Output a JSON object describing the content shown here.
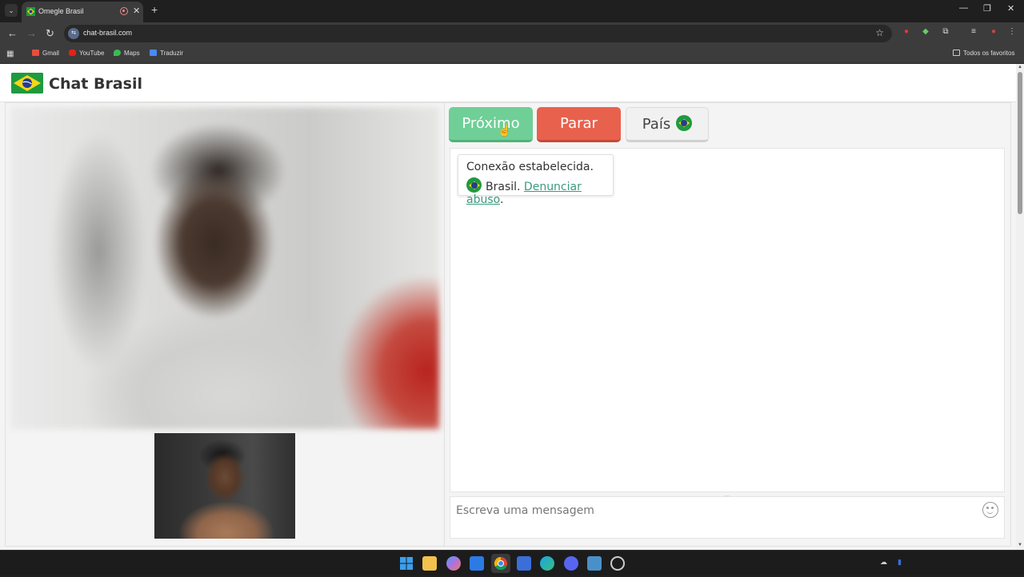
{
  "browser": {
    "tab_title": "Omegle Brasil",
    "url": "chat-brasil.com",
    "bookmarks": [
      "Gmail",
      "YouTube",
      "Maps",
      "Traduzir"
    ],
    "all_favorites": "Todos os favoritos"
  },
  "site": {
    "title": "Chat Brasil"
  },
  "controls": {
    "next_label": "Próximo",
    "stop_label": "Parar",
    "country_label": "País"
  },
  "chat": {
    "status": "Conexão estabelecida.",
    "country": "Brasil.",
    "report_link": "Denunciar abuso",
    "trailing_period": ".",
    "input_placeholder": "Escreva uma mensagem"
  },
  "colors": {
    "next": "#6fcf97",
    "stop": "#e8614d",
    "link": "#3a9a7e"
  },
  "icons": [
    "back-icon",
    "forward-icon",
    "reload-icon",
    "star-icon",
    "emoji-icon",
    "brazil-flag-icon"
  ]
}
